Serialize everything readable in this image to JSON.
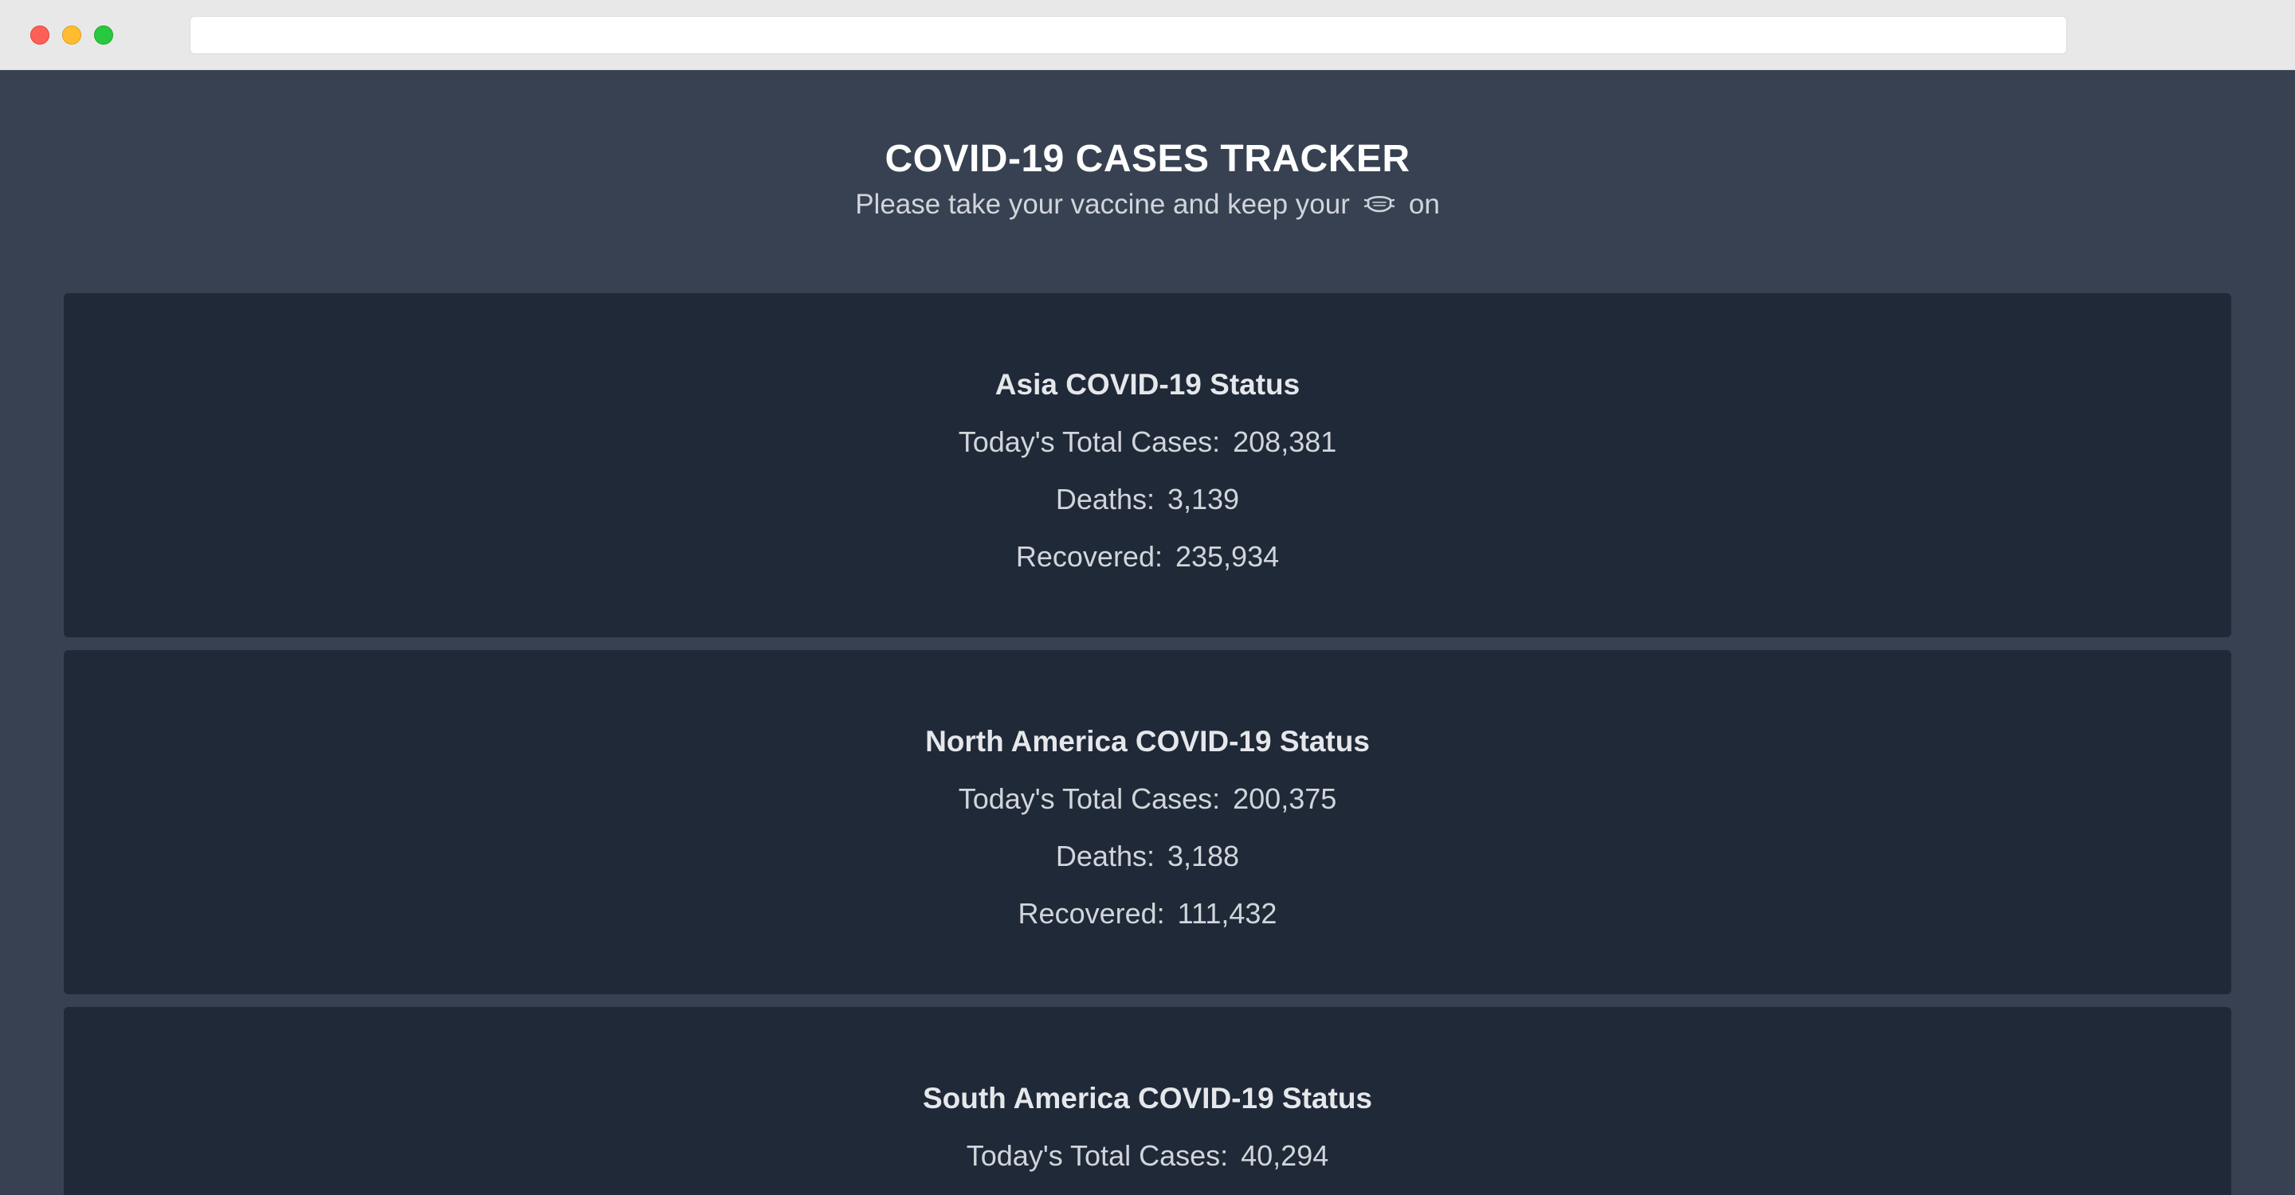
{
  "header": {
    "title": "COVID-19 CASES TRACKER",
    "subtitle_before": "Please take your vaccine and keep your",
    "subtitle_icon": "face-mask-icon",
    "subtitle_after": "on"
  },
  "regions": [
    {
      "title": "Asia COVID-19 Status",
      "cases_label": "Today's Total Cases:",
      "cases": "208,381",
      "deaths_label": "Deaths:",
      "deaths": "3,139",
      "recovered_label": "Recovered:",
      "recovered": "235,934"
    },
    {
      "title": "North America COVID-19 Status",
      "cases_label": "Today's Total Cases:",
      "cases": "200,375",
      "deaths_label": "Deaths:",
      "deaths": "3,188",
      "recovered_label": "Recovered:",
      "recovered": "111,432"
    },
    {
      "title": "South America COVID-19 Status",
      "cases_label": "Today's Total Cases:",
      "cases": "40,294"
    }
  ],
  "colors": {
    "page_bg": "#374151",
    "card_bg": "#1f2937",
    "title": "#ffffff",
    "text": "#d1d5db"
  }
}
